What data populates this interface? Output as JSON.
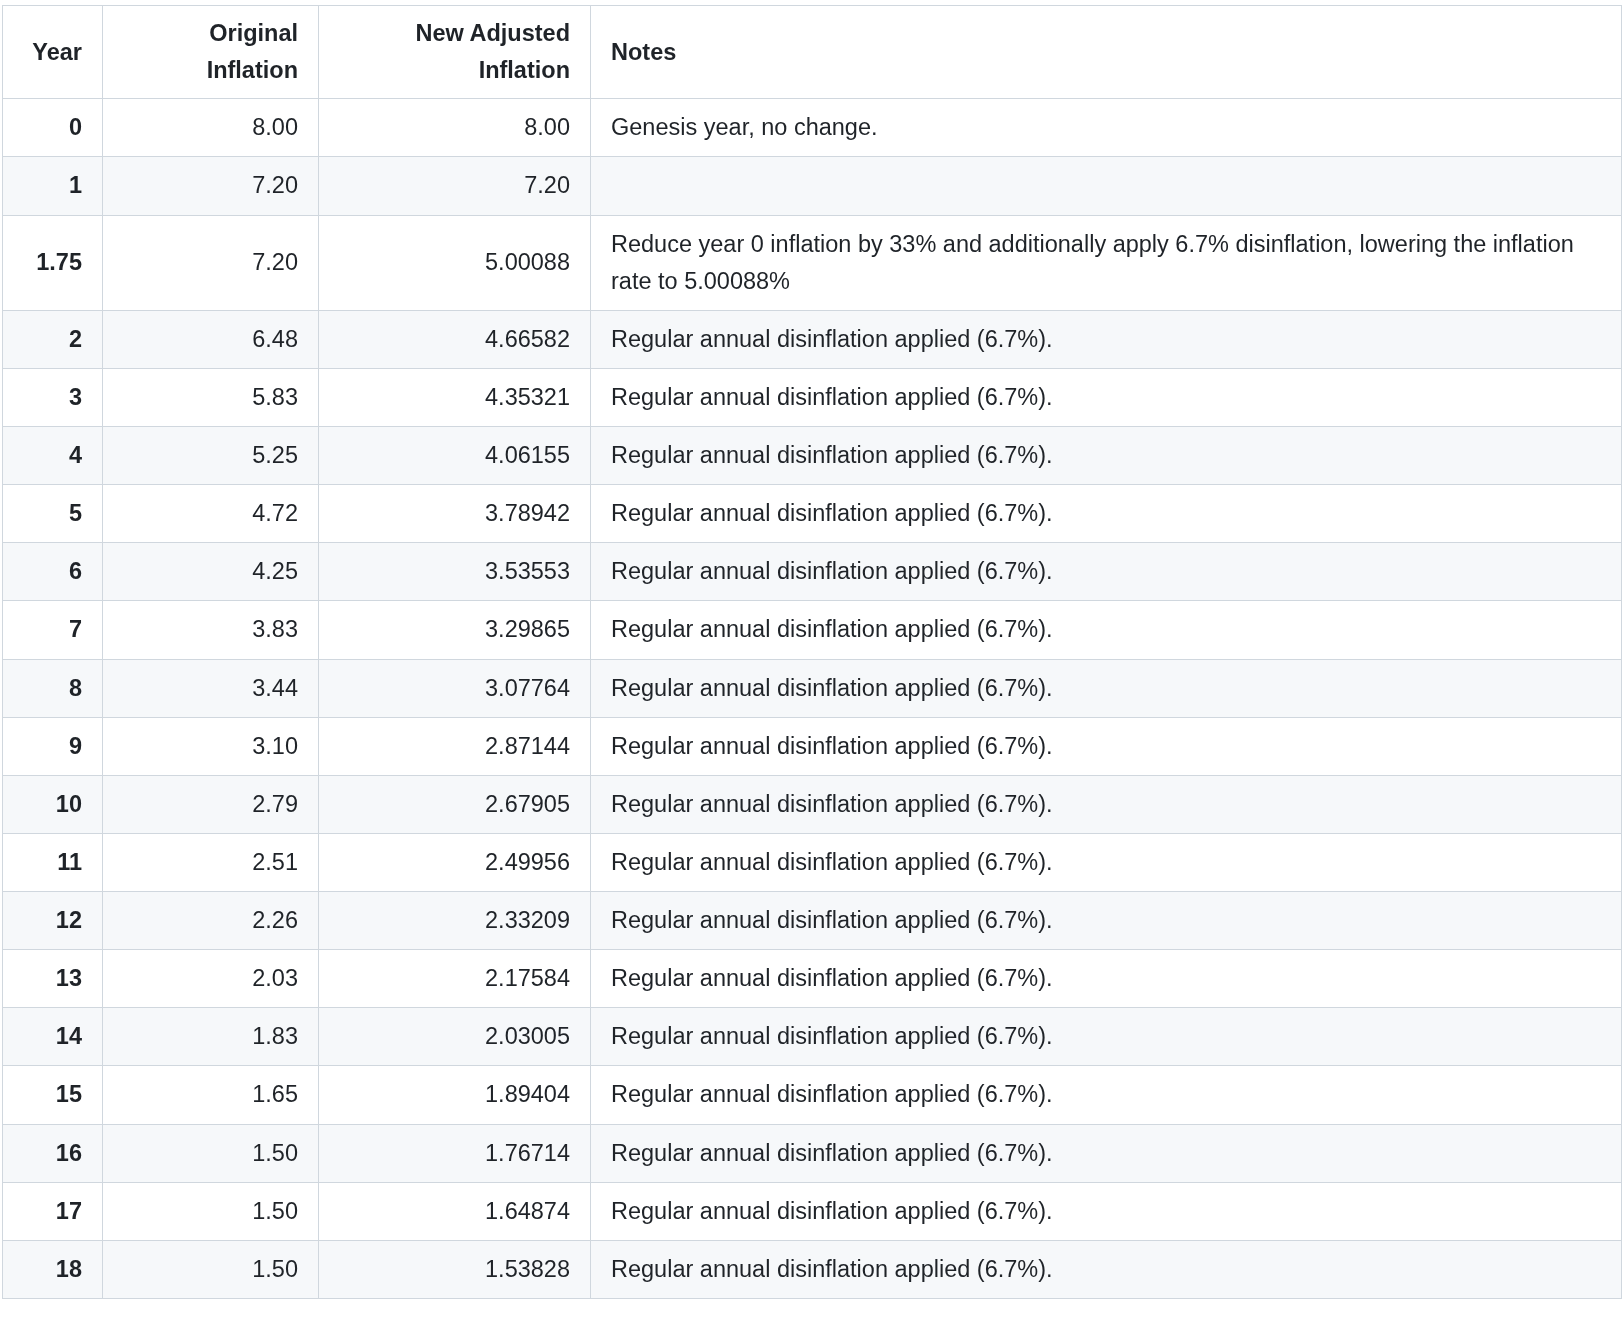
{
  "table": {
    "columns": [
      {
        "label": "Year"
      },
      {
        "label": "Original Inflation"
      },
      {
        "label": "New Adjusted Inflation"
      },
      {
        "label": "Notes"
      }
    ],
    "rows": [
      {
        "year": "0",
        "original": "8.00",
        "adjusted": "8.00",
        "notes": "Genesis year, no change."
      },
      {
        "year": "1",
        "original": "7.20",
        "adjusted": "7.20"
      },
      {
        "year": "1.75",
        "original": "7.20",
        "adjusted": "5.00088",
        "notes": "Reduce year 0 inflation by 33% and additionally apply 6.7% disinflation, lowering the inflation rate to 5.00088%"
      },
      {
        "year": "2",
        "original": "6.48",
        "adjusted": "4.66582",
        "notes": "Regular annual disinflation applied (6.7%)."
      },
      {
        "year": "3",
        "original": "5.83",
        "adjusted": "4.35321",
        "notes": "Regular annual disinflation applied (6.7%)."
      },
      {
        "year": "4",
        "original": "5.25",
        "adjusted": "4.06155",
        "notes": "Regular annual disinflation applied (6.7%)."
      },
      {
        "year": "5",
        "original": "4.72",
        "adjusted": "3.78942",
        "notes": "Regular annual disinflation applied (6.7%)."
      },
      {
        "year": "6",
        "original": "4.25",
        "adjusted": "3.53553",
        "notes": "Regular annual disinflation applied (6.7%)."
      },
      {
        "year": "7",
        "original": "3.83",
        "adjusted": "3.29865",
        "notes": "Regular annual disinflation applied (6.7%)."
      },
      {
        "year": "8",
        "original": "3.44",
        "adjusted": "3.07764",
        "notes": "Regular annual disinflation applied (6.7%)."
      },
      {
        "year": "9",
        "original": "3.10",
        "adjusted": "2.87144",
        "notes": "Regular annual disinflation applied (6.7%)."
      },
      {
        "year": "10",
        "original": "2.79",
        "adjusted": "2.67905",
        "notes": "Regular annual disinflation applied (6.7%)."
      },
      {
        "year": "11",
        "original": "2.51",
        "adjusted": "2.49956",
        "notes": "Regular annual disinflation applied (6.7%)."
      },
      {
        "year": "12",
        "original": "2.26",
        "adjusted": "2.33209",
        "notes": "Regular annual disinflation applied (6.7%)."
      },
      {
        "year": "13",
        "original": "2.03",
        "adjusted": "2.17584",
        "notes": "Regular annual disinflation applied (6.7%)."
      },
      {
        "year": "14",
        "original": "1.83",
        "adjusted": "2.03005",
        "notes": "Regular annual disinflation applied (6.7%)."
      },
      {
        "year": "15",
        "original": "1.65",
        "adjusted": "1.89404",
        "notes": "Regular annual disinflation applied (6.7%)."
      },
      {
        "year": "16",
        "original": "1.50",
        "adjusted": "1.76714",
        "notes": "Regular annual disinflation applied (6.7%)."
      },
      {
        "year": "17",
        "original": "1.50",
        "adjusted": "1.64874",
        "notes": "Regular annual disinflation applied (6.7%)."
      },
      {
        "year": "18",
        "original": "1.50",
        "adjusted": "1.53828",
        "notes": "Regular annual disinflation applied (6.7%)."
      }
    ]
  }
}
